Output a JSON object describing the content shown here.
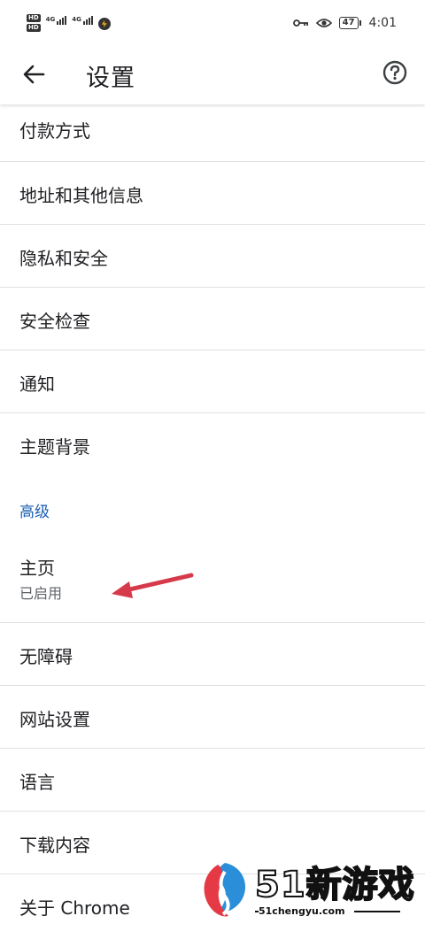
{
  "status_bar": {
    "hd1": "HD",
    "hd2": "HD",
    "net1": "4G",
    "net2": "4G",
    "battery": "47",
    "time": "4:01"
  },
  "toolbar": {
    "title": "设置"
  },
  "settings": {
    "items": [
      {
        "label": "付款方式"
      },
      {
        "label": "地址和其他信息"
      },
      {
        "label": "隐私和安全"
      },
      {
        "label": "安全检查"
      },
      {
        "label": "通知"
      },
      {
        "label": "主题背景"
      }
    ],
    "section_header": "高级",
    "homepage": {
      "label": "主页",
      "sub": "已启用"
    },
    "items2": [
      {
        "label": "无障碍"
      },
      {
        "label": "网站设置"
      },
      {
        "label": "语言"
      },
      {
        "label": "下载内容"
      },
      {
        "label": "关于 Chrome"
      }
    ]
  },
  "watermark": {
    "brand": "51新游戏",
    "url": "51chengyu.com"
  },
  "colors": {
    "accent": "#1a5fb4",
    "annotation": "#d63a4a"
  }
}
